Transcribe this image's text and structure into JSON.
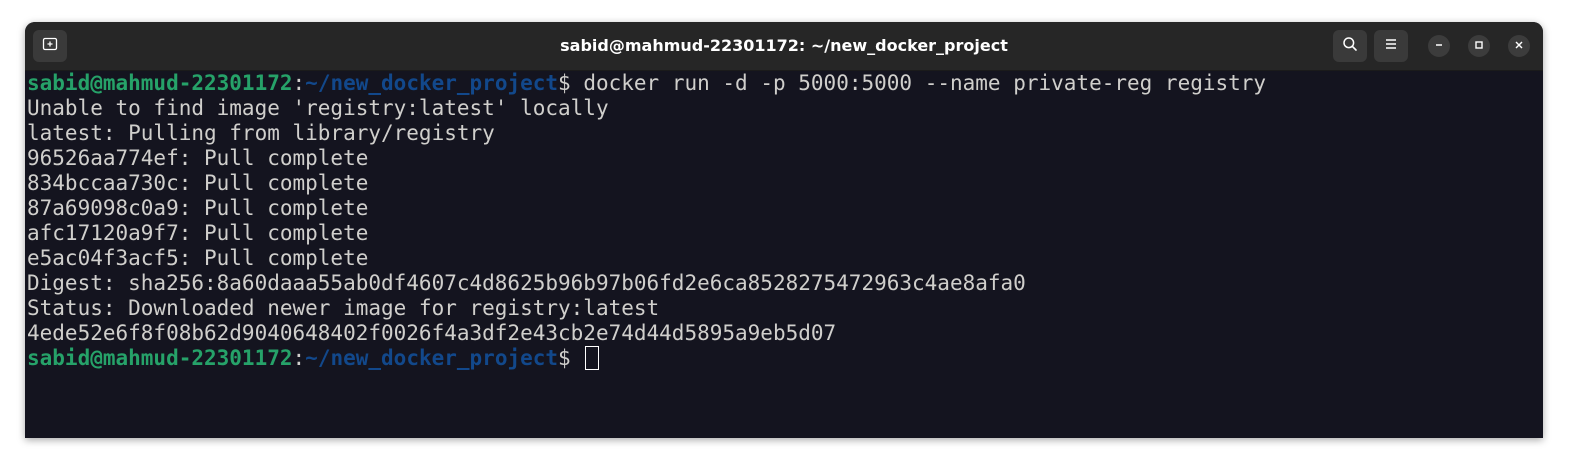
{
  "window": {
    "title": "sabid@mahmud-22301172: ~/new_docker_project"
  },
  "titlebar_icons": {
    "new_tab": "new-tab-icon",
    "search": "search-icon",
    "menu": "hamburger-menu-icon",
    "minimize": "minimize-icon",
    "maximize": "maximize-icon",
    "close": "close-icon"
  },
  "prompt": {
    "user_host": "sabid@mahmud-22301172",
    "colon": ":",
    "path": "~/new_docker_project",
    "dollar": "$ "
  },
  "command": "docker run -d -p 5000:5000 --name private-reg registry",
  "output": [
    "Unable to find image 'registry:latest' locally",
    "latest: Pulling from library/registry",
    "96526aa774ef: Pull complete",
    "834bccaa730c: Pull complete",
    "87a69098c0a9: Pull complete",
    "afc17120a9f7: Pull complete",
    "e5ac04f3acf5: Pull complete",
    "Digest: sha256:8a60daaa55ab0df4607c4d8625b96b97b06fd2e6ca8528275472963c4ae8afa0",
    "Status: Downloaded newer image for registry:latest",
    "4ede52e6f8f08b62d9040648402f0026f4a3df2e43cb2e74d44d5895a9eb5d07"
  ],
  "colors": {
    "terminal_bg": "#14141f",
    "prompt_user": "#26a269",
    "prompt_path": "#12488b",
    "text": "#d0cfcc",
    "titlebar_bg": "#262626"
  }
}
